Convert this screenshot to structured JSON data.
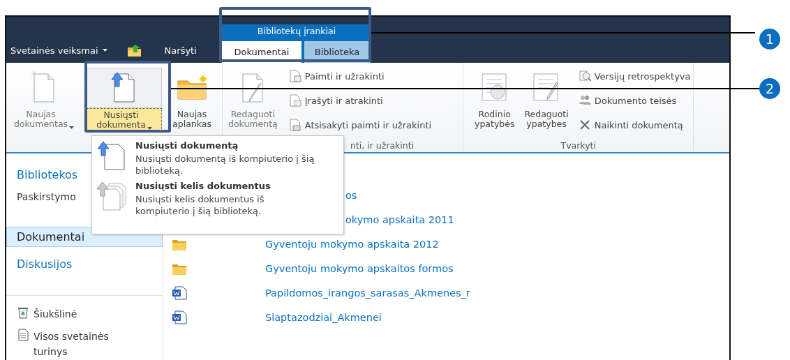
{
  "header": {
    "site_actions": "Svetainės veiksmai",
    "browse_tab": "Naršyti",
    "context_group": "Bibliotekų įrankiai",
    "tabs": [
      {
        "label": "Dokumentai",
        "selected": true
      },
      {
        "label": "Biblioteka",
        "selected": false
      }
    ]
  },
  "ribbon": {
    "groups": [
      {
        "items": [
          {
            "kind": "large",
            "label": "Naujas dokumentas",
            "dropdown": true,
            "disabled": true,
            "highlighted": false
          },
          {
            "kind": "large",
            "label": "Nusiųsti dokumenta",
            "dropdown": true,
            "disabled": false,
            "highlighted": true
          },
          {
            "kind": "large",
            "label": "Naujas aplankas",
            "dropdown": false,
            "disabled": false,
            "highlighted": false
          }
        ]
      },
      {
        "label": "nti, ir užrakinti",
        "items": [
          {
            "kind": "large",
            "label": "Redaguoti dokumentą",
            "dropdown": false,
            "disabled": true,
            "highlighted": false
          },
          {
            "kind": "small",
            "label": "Paimti ir užrakinti"
          },
          {
            "kind": "small",
            "label": "Įrašyti ir atrakinti"
          },
          {
            "kind": "small",
            "label": "Atsisakyti paimti ir užrakinti"
          }
        ]
      },
      {
        "label": "Tvarkyti",
        "items": [
          {
            "kind": "large",
            "label": "Rodinio ypatybės",
            "dropdown": false,
            "disabled": false,
            "highlighted": false
          },
          {
            "kind": "large",
            "label": "Redaguoti ypatybes",
            "dropdown": false,
            "disabled": false,
            "highlighted": false
          },
          {
            "kind": "small",
            "label": "Versijų retrospektyva"
          },
          {
            "kind": "small",
            "label": "Dokumento teisės"
          },
          {
            "kind": "small",
            "label": "Naikinti dokumentą"
          }
        ]
      }
    ]
  },
  "menu": {
    "items": [
      {
        "title": "Nusiųsti dokumentą",
        "description": "Nusiųsti dokumentą iš kompiuterio į šią biblioteką."
      },
      {
        "title": "Nusiųsti kelis dokumentus",
        "description": "Nusiųsti kelis dokumentus iš kompiuterio į šią biblioteką."
      }
    ]
  },
  "sidebar": {
    "items": [
      {
        "kind": "heading",
        "label": "Bibliotekos",
        "selected": false
      },
      {
        "kind": "link",
        "label": "Paskirstymo",
        "selected": false
      },
      {
        "kind": "heading",
        "label": "Dokumentai",
        "selected": true
      },
      {
        "kind": "heading",
        "label": "Diskusijos",
        "selected": false
      },
      {
        "kind": "utility",
        "label": "Šiukšlinė",
        "selected": false
      },
      {
        "kind": "utility",
        "label": "Visos svetainės turinys",
        "selected": false
      }
    ]
  },
  "documents": {
    "rows": [
      {
        "name": "os"
      },
      {
        "name": "okymo apskaita 2011"
      },
      {
        "kind": "folder",
        "name": "Gyventoju mokymo apskaita 2012"
      },
      {
        "kind": "folder",
        "name": "Gyventoju mokymo apskaitos formos"
      },
      {
        "kind": "word",
        "name": "Papildomos_irangos_sarasas_Akmenes_r"
      },
      {
        "kind": "word",
        "name": "Slaptazodziai_Akmenei"
      }
    ]
  },
  "callouts": [
    "1",
    "2"
  ]
}
